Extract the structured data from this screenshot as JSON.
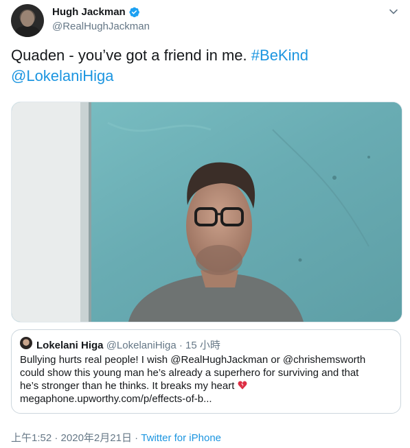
{
  "author": {
    "name": "Hugh Jackman",
    "handle": "@RealHughJackman"
  },
  "tweet": {
    "text_plain": "Quaden - you’ve got a friend in me.",
    "hashtag": "#BeKind",
    "mention": "@LokelaniHiga"
  },
  "quoted": {
    "name": "Lokelani Higa",
    "handle": "@LokelaniHiga",
    "separator": "·",
    "time": "15 小時",
    "line1": "Bullying hurts real people! I wish @RealHughJackman or @chrishemsworth",
    "line2": "could show this young man he’s already a superhero for surviving and that",
    "line3": "he’s stronger than he thinks. It breaks my heart",
    "line4": "megaphone.upworthy.com/p/effects-of-b..."
  },
  "footer": {
    "time": "上午1:52",
    "separator1": "·",
    "date": "2020年2月21日",
    "separator2": "·",
    "source": "Twitter for iPhone"
  },
  "colors": {
    "link": "#1b95e0",
    "meta": "#657786",
    "verified": "#1da1f2",
    "wall": "#6fb2b8"
  },
  "icons": {
    "verified": "verified-badge-icon",
    "caret": "chevron-down-icon",
    "broken_heart": "broken-heart-icon"
  }
}
